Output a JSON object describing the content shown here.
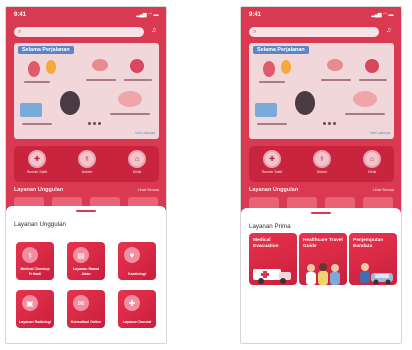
{
  "colors": {
    "brand_red": "#d93a52",
    "card_red": "#c9243d",
    "banner_bg": "#f1d7da",
    "banner_title_bg": "#5a86c7",
    "sheet_bg": "#ffffff"
  },
  "screens": [
    {
      "status_bar": {
        "time": "9:41"
      },
      "home": {
        "banner_title": "Selama Perjalanan",
        "banner_link": "Info Lainnya",
        "quick_actions": [
          {
            "label": "Rumah Sakit",
            "icon": "hospital-icon"
          },
          {
            "label": "Dokter",
            "icon": "doctor-icon"
          },
          {
            "label": "Klinik",
            "icon": "clinic-icon"
          }
        ],
        "section_title": "Layanan Unggulan",
        "section_link": "Lihat Semua"
      },
      "sheet": {
        "title": "Layanan Unggulan",
        "tiles": [
          {
            "label": "Medical Checkup Pribadi",
            "icon": "stethoscope-icon"
          },
          {
            "label": "Layanan Rawat Jalan",
            "icon": "clipboard-icon"
          },
          {
            "label": "Kardiologi",
            "icon": "heart-icon"
          },
          {
            "label": "Layanan Radiologi",
            "icon": "xray-icon"
          },
          {
            "label": "Konsultasi Online",
            "icon": "chat-icon"
          },
          {
            "label": "Layanan Darurat",
            "icon": "ambulance-icon"
          }
        ]
      }
    },
    {
      "status_bar": {
        "time": "9:41"
      },
      "home": {
        "banner_title": "Selama Perjalanan",
        "banner_link": "Info Lainnya",
        "quick_actions": [
          {
            "label": "Rumah Sakit",
            "icon": "hospital-icon"
          },
          {
            "label": "Dokter",
            "icon": "doctor-icon"
          },
          {
            "label": "Klinik",
            "icon": "clinic-icon"
          }
        ],
        "section_title": "Layanan Unggulan",
        "section_link": "Lihat Semua"
      },
      "sheet": {
        "title": "Layanan Prima",
        "cards": [
          {
            "label": "Medical Evacuation",
            "art": "ambulance-art"
          },
          {
            "label": "Healthcare Travel Guide",
            "art": "people-art"
          },
          {
            "label": "Penjemputan Bandara",
            "art": "airport-art"
          }
        ]
      }
    }
  ]
}
